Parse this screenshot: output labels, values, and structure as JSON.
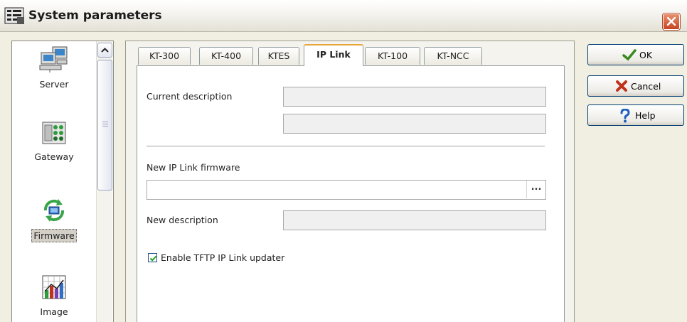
{
  "window": {
    "title": "System parameters",
    "close_icon": "close-icon"
  },
  "sidebar": {
    "items": [
      {
        "label": "Server",
        "icon": "server-icon",
        "selected": false
      },
      {
        "label": "Gateway",
        "icon": "gateway-icon",
        "selected": false
      },
      {
        "label": "Firmware",
        "icon": "firmware-icon",
        "selected": true
      },
      {
        "label": "Image",
        "icon": "image-chart-icon",
        "selected": false
      }
    ]
  },
  "tabs": [
    {
      "label": "KT-300",
      "active": false
    },
    {
      "label": "KT-400",
      "active": false
    },
    {
      "label": "KTES",
      "active": false
    },
    {
      "label": "IP Link",
      "active": true
    },
    {
      "label": "KT-100",
      "active": false
    },
    {
      "label": "KT-NCC",
      "active": false
    }
  ],
  "form": {
    "current_description_label": "Current description",
    "current_description_line1": "",
    "current_description_line2": "",
    "firmware_label": "New IP Link firmware",
    "firmware_value": "",
    "browse_label": "...",
    "new_description_label": "New description",
    "new_description_value": "",
    "tftp_checkbox_label": "Enable TFTP IP Link updater",
    "tftp_checked": true
  },
  "buttons": {
    "ok_label": "OK",
    "cancel_label": "Cancel",
    "help_label": "Help"
  },
  "colors": {
    "accent": "#e6a63a",
    "ok_check": "#3a8a1f",
    "cancel_x": "#c0321b",
    "help": "#1f5fbf"
  }
}
